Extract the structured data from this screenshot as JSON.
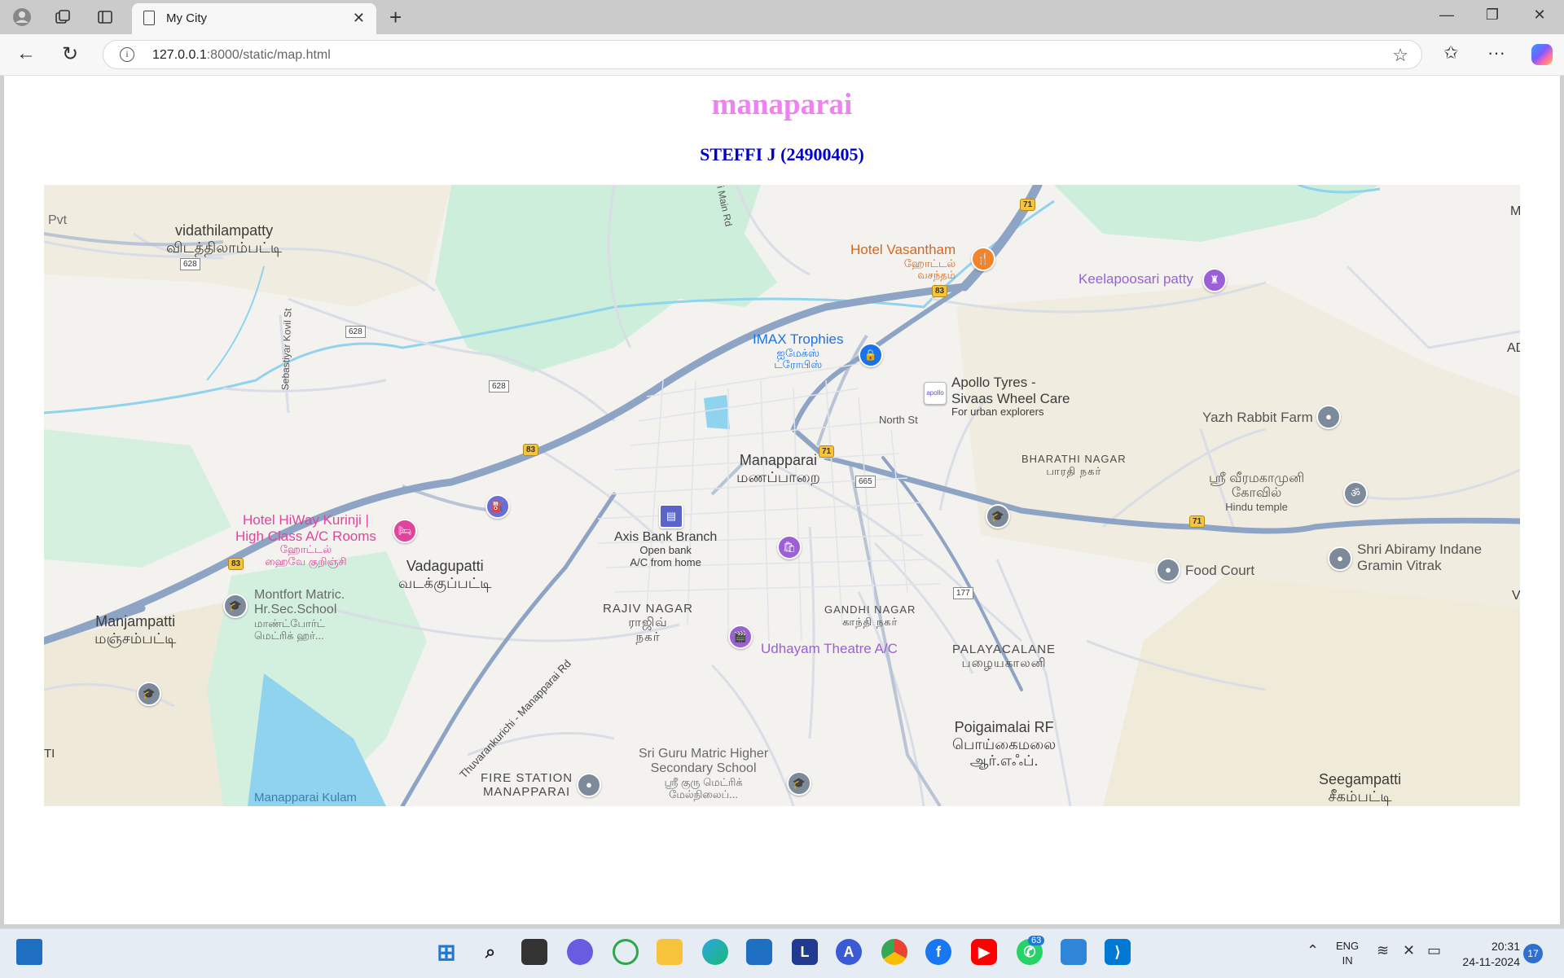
{
  "browser": {
    "tab_title": "My City",
    "url_host": "127.0.0.1",
    "url_rest": ":8000/static/map.html"
  },
  "page": {
    "heading": "manaparai",
    "subheading": "STEFFI J (24900405)"
  },
  "map": {
    "places": {
      "pvt": "Pvt",
      "vidathilampatty": "vidathilampatty",
      "vidathilampatty_ta": "விடத்திலாம்பட்டி",
      "sebastiyar": "Sebastiyar Kovil St",
      "main_rd": "i Main Rd",
      "hotel_vasantham": "Hotel Vasantham",
      "hotel_vasantham_ta1": "ஹோட்டல்",
      "hotel_vasantham_ta2": "வசந்தம்",
      "keelapoosari": "Keelapoosari patty",
      "imax": "IMAX Trophies",
      "imax_ta1": "ஐமேக்ஸ்",
      "imax_ta2": "ட்ரோபிஸ்",
      "apollo1": "Apollo Tyres -",
      "apollo2": "Sivaas Wheel Care",
      "apollo3": "For urban explorers",
      "north_st": "North St",
      "yazh": "Yazh Rabbit Farm",
      "bharathi": "BHARATHI NAGAR",
      "bharathi_ta": "பாரதி நகர்",
      "manapparai": "Manapparai",
      "manapparai_ta": "மணப்பாறை",
      "temple_ta1": "ஸ்ரீ வீரமகாமுனி",
      "temple_ta2": "கோவில்",
      "temple_en": "Hindu temple",
      "hiway1": "Hotel HiWay Kurinji |",
      "hiway2": "High Class A/C Rooms",
      "hiway_ta1": "ஹோட்டல்",
      "hiway_ta2": "ஹைவே குறிஞ்சி",
      "axis": "Axis Bank Branch",
      "axis_sub1": "Open bank",
      "axis_sub2": "A/C from home",
      "vadagupatti": "Vadagupatti",
      "vadagupatti_ta": "வடக்குப்பட்டி",
      "montfort1": "Montfort Matric.",
      "montfort2": "Hr.Sec.School",
      "montfort_ta1": "மாண்ட்போர்ட்",
      "montfort_ta2": "மெட்ரிக் ஹர்...",
      "manjampatti": "Manjampatti",
      "manjampatti_ta": "மஞ்சம்பட்டி",
      "rajiv": "RAJIV NAGAR",
      "rajiv_ta1": "ராஜிவ்",
      "rajiv_ta2": "நகர்",
      "gandhi": "GANDHI NAGAR",
      "gandhi_ta": "காந்தி நகர்",
      "udhayam": "Udhayam Theatre A/C",
      "food_court": "Food Court",
      "abirami1": "Shri Abiramy Indane",
      "abirami2": "Gramin Vitrak",
      "palayacalane": "PALAYACALANE",
      "palayacalane_ta": "பழையகாலனி",
      "thuvarankurichi": "Thuvarankurichi - Manapparai Rd",
      "poigaimalai": "Poigaimalai RF",
      "poigaimalai_ta1": "பொய்கைமலை",
      "poigaimalai_ta2": "ஆர்.எஃப்.",
      "fire1": "FIRE STATION",
      "fire2": "MANAPPARAI",
      "guru1": "Sri Guru Matric Higher",
      "guru2": "Secondary School",
      "guru_ta1": "ஸ்ரீ குரு மெட்ரிக்",
      "guru_ta2": "மேல்நிலைப்...",
      "seegampatti": "Seegampatti",
      "seegampatti_ta": "சீகம்பட்டி",
      "kulam": "Manapparai Kulam",
      "edge_ti": "TI",
      "edge_m": "M",
      "edge_ad": "AD",
      "edge_v": "V"
    },
    "road_labels": {
      "r628a": "628",
      "r628b": "628",
      "r628c": "628",
      "r83a": "83",
      "r83b": "83",
      "r83c": "83",
      "r71a": "71",
      "r71b": "71",
      "r71c": "71",
      "r665": "665",
      "r177": "177"
    }
  },
  "taskbar": {
    "lang1": "ENG",
    "lang2": "IN",
    "time": "20:31",
    "date": "24-11-2024",
    "whatsapp_badge": "63",
    "notif_count": "17"
  },
  "colors": {
    "heading": "#ee82ee",
    "subheading": "#0000cd",
    "highway": "#8ea4c4",
    "water": "#8fd3ef",
    "park": "#cdeedb"
  }
}
